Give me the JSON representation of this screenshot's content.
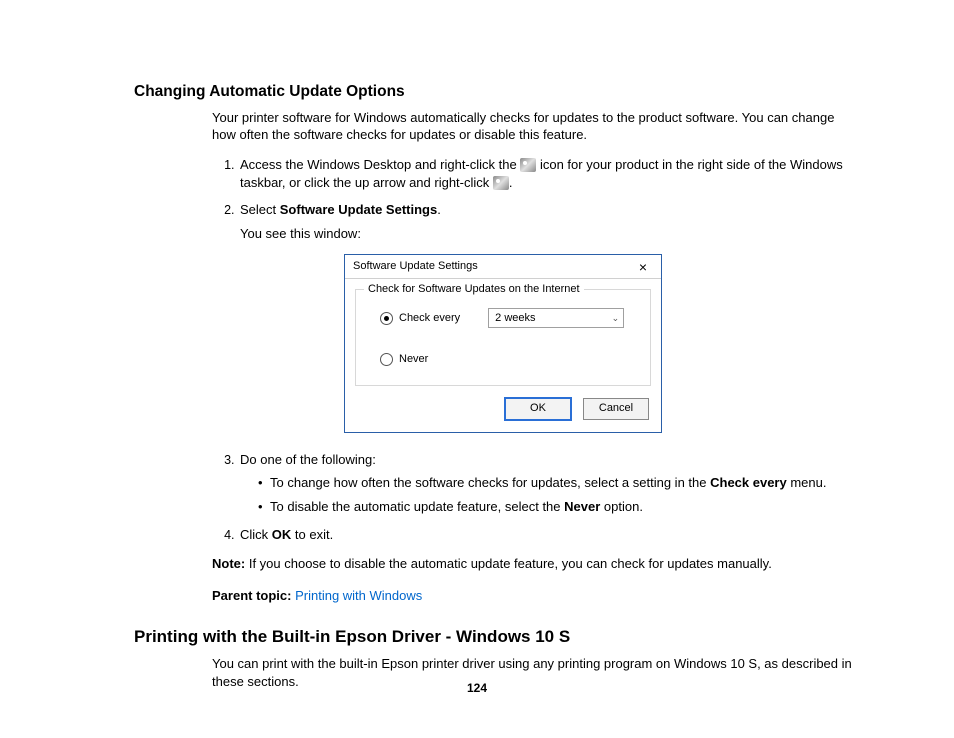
{
  "section1": {
    "heading": "Changing Automatic Update Options",
    "intro": "Your printer software for Windows automatically checks for updates to the product software. You can change how often the software checks for updates or disable this feature.",
    "steps": {
      "s1a": "Access the Windows Desktop and right-click the ",
      "s1b": " icon for your product in the right side of the Windows taskbar, or click the up arrow and right-click ",
      "s1c": ".",
      "s2a": "Select ",
      "s2b": "Software Update Settings",
      "s2c": ".",
      "s2_sub": "You see this window:",
      "s3": "Do one of the following:",
      "s3_b1a": "To change how often the software checks for updates, select a setting in the ",
      "s3_b1b": "Check every",
      "s3_b1c": " menu.",
      "s3_b2a": "To disable the automatic update feature, select the ",
      "s3_b2b": "Never",
      "s3_b2c": " option.",
      "s4a": "Click ",
      "s4b": "OK",
      "s4c": " to exit."
    },
    "note_label": "Note:",
    "note_text": " If you choose to disable the automatic update feature, you can check for updates manually.",
    "parent_label": "Parent topic:",
    "parent_link": "Printing with Windows"
  },
  "dialog": {
    "title": "Software Update Settings",
    "group_legend": "Check for Software Updates on the Internet",
    "radio_check_every": "Check every",
    "combo_value": "2 weeks",
    "radio_never": "Never",
    "btn_ok": "OK",
    "btn_cancel": "Cancel"
  },
  "section2": {
    "heading": "Printing with the Built-in Epson Driver - Windows 10 S",
    "intro": "You can print with the built-in Epson printer driver using any printing program on Windows 10 S, as described in these sections."
  },
  "page_number": "124"
}
